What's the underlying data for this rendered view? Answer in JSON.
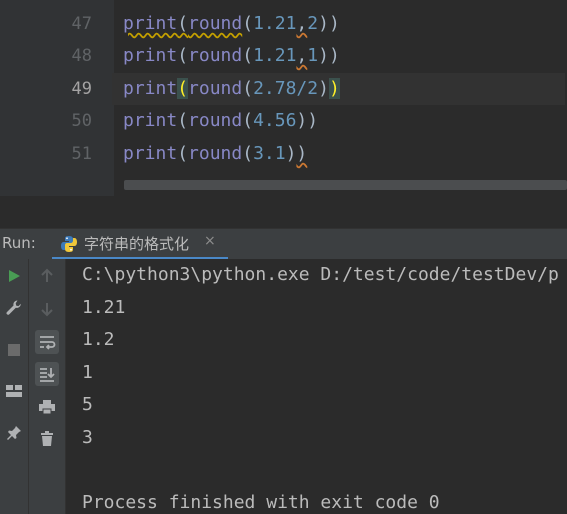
{
  "editor": {
    "lines": [
      {
        "num": "47",
        "fn": "print",
        "inner": "round",
        "args": "1.21,2",
        "a1": "1.21",
        "a2": "2"
      },
      {
        "num": "48",
        "fn": "print",
        "inner": "round",
        "args": "1.21,1",
        "a1": "1.21",
        "a2": "1"
      },
      {
        "num": "49",
        "fn": "print",
        "inner": "round",
        "a1": "2.78/2"
      },
      {
        "num": "50",
        "fn": "print",
        "inner": "round",
        "a1": "4.56"
      },
      {
        "num": "51",
        "fn": "print",
        "inner": "round",
        "a1": "3.1"
      }
    ],
    "current_line": "49"
  },
  "run": {
    "label": "Run:",
    "tab_label": "字符串的格式化",
    "tab_close": "×"
  },
  "console": {
    "lines": [
      "C:\\python3\\python.exe D:/test/code/testDev/p",
      "1.21",
      "1.2",
      "1",
      "5",
      "3",
      "",
      "Process finished with exit code 0"
    ]
  },
  "colors": {
    "editor_bg": "#2b2b2b",
    "keyword": "#8888c6",
    "number": "#6897bb",
    "text": "#a9b7c6",
    "run_green": "#499c54",
    "tab_underline": "#4a88c7"
  }
}
